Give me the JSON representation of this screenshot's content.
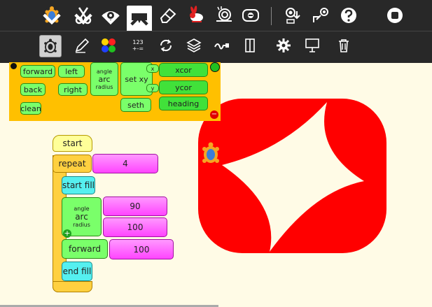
{
  "colors": {
    "toolbar_bg": "#282828",
    "palette_bg": "#ffc000",
    "canvas_bg": "#fffbe6",
    "shape_red": "#ff0000",
    "flow_green": "#7aff6a",
    "number_magenta": "#ff4cff",
    "fill_cyan": "#55f0f0",
    "start_yellow": "#ffff99"
  },
  "toolbar": {
    "icons": [
      "turtle-icon",
      "scissors-icon",
      "eye-icon",
      "palette-toolbar-icon",
      "eraser-icon",
      "rabbit-icon",
      "snail-icon",
      "step-icon",
      "save-icon",
      "load-icon",
      "help-icon",
      "stop-icon"
    ]
  },
  "subtoolbar": {
    "number_glyph_top": "123",
    "number_glyph_bottom": "+-="
  },
  "palette": {
    "blocks": {
      "forward": "forward",
      "back": "back",
      "clean": "clean",
      "left": "left",
      "right": "right",
      "arc": "arc",
      "arc_angle": "angle",
      "arc_radius": "radius",
      "setxy": "set xy",
      "setxy_x": "x",
      "setxy_y": "y",
      "xcor": "xcor",
      "ycor": "ycor",
      "seth": "seth",
      "heading": "heading"
    }
  },
  "program": {
    "start": "start",
    "repeat": "repeat",
    "repeat_count": "4",
    "start_fill": "start fill",
    "arc": "arc",
    "arc_angle_label": "angle",
    "arc_radius_label": "radius",
    "arc_angle": "90",
    "arc_radius": "100",
    "forward": "forward",
    "forward_value": "100",
    "end_fill": "end fill"
  }
}
